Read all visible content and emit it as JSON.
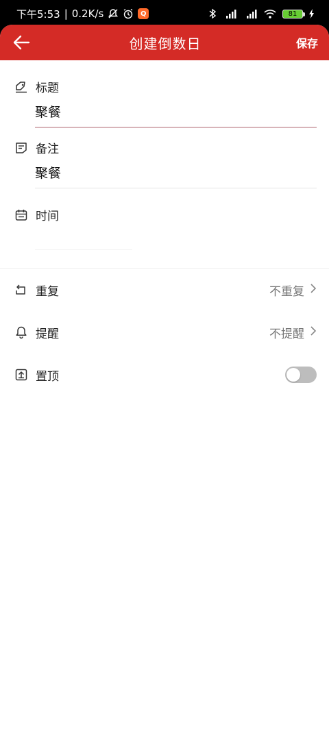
{
  "status_bar": {
    "time": "下午5:53",
    "speed": "0.2K/s",
    "battery": "81"
  },
  "header": {
    "title": "创建倒数日",
    "save_label": "保存"
  },
  "form": {
    "title_label": "标题",
    "title_value": "聚餐",
    "note_label": "备注",
    "note_value": "聚餐",
    "time_label": "时间",
    "time_value": ""
  },
  "settings": {
    "repeat_label": "重复",
    "repeat_value": "不重复",
    "remind_label": "提醒",
    "remind_value": "不提醒",
    "pin_label": "置顶"
  },
  "colors": {
    "accent": "#d42b26",
    "toggle_off": "#bdbdbd"
  },
  "icons": {
    "back": "arrow-left-icon",
    "title": "title-tag-icon",
    "note": "note-icon",
    "time": "calendar-icon",
    "repeat": "repeat-icon",
    "remind": "bell-icon",
    "pin": "pin-top-icon",
    "chevron": "chevron-right-icon"
  }
}
